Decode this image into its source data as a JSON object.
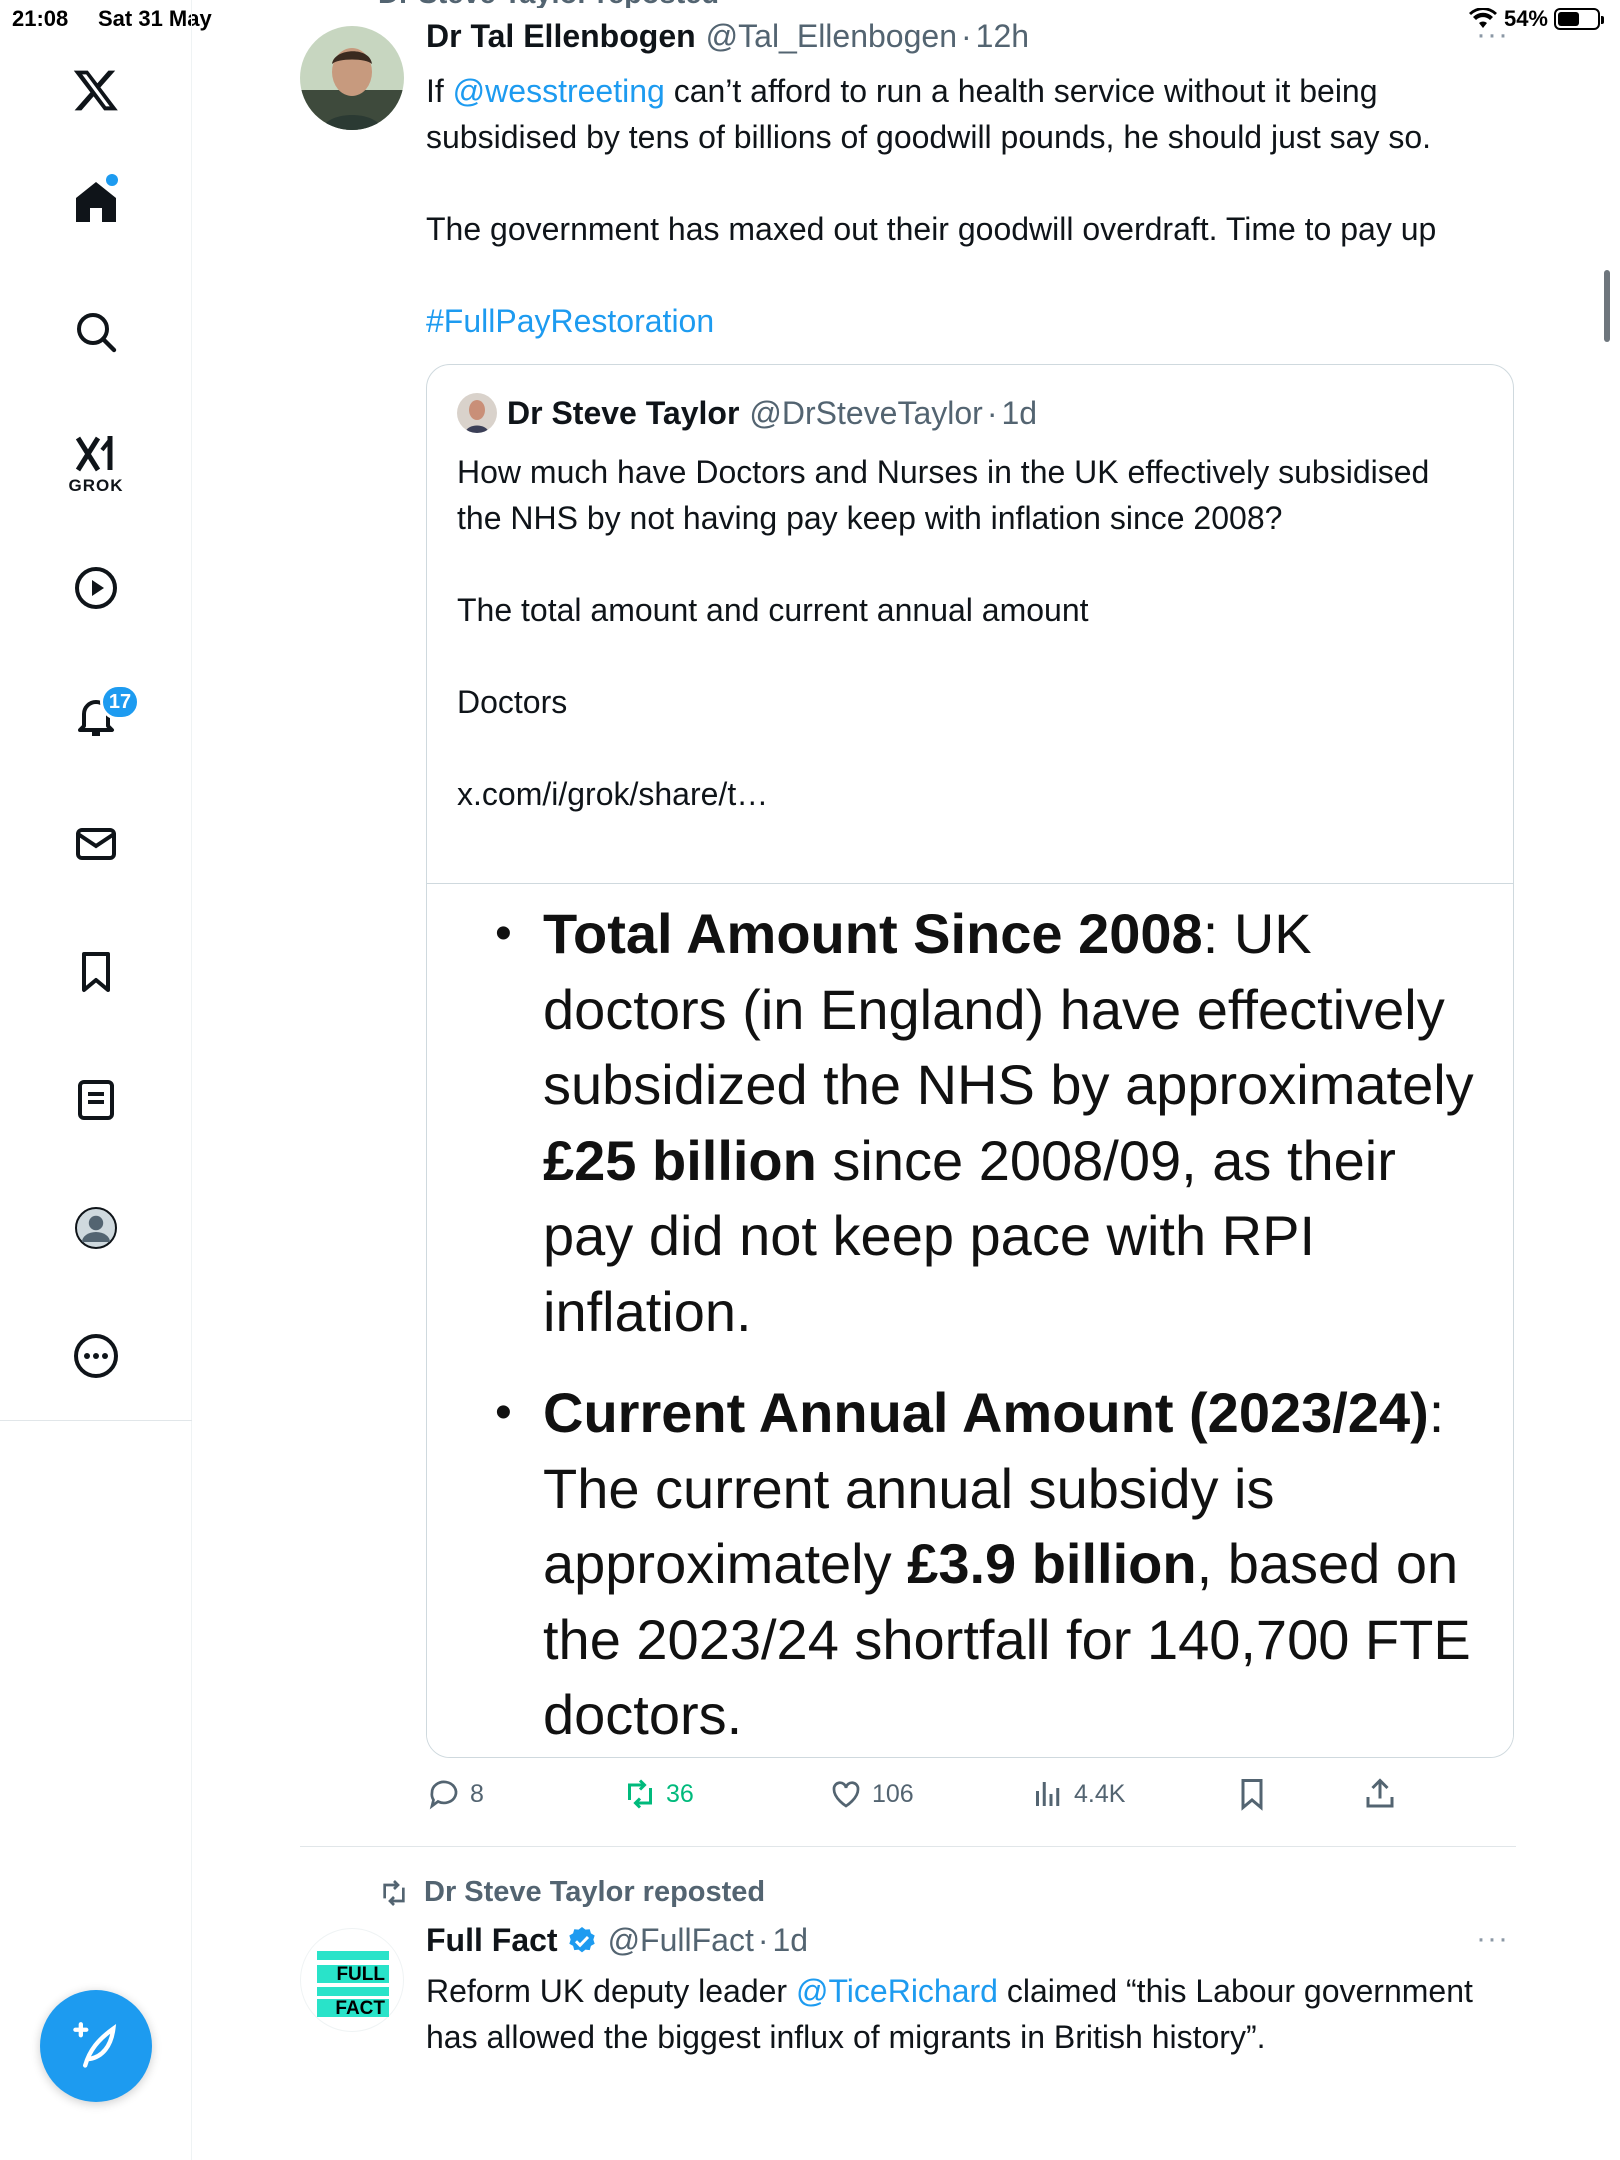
{
  "status_bar": {
    "time": "21:08",
    "date": "Sat 31 May",
    "battery_percent": "54%"
  },
  "sidebar": {
    "items": [
      "home",
      "explore",
      "grok",
      "video",
      "notifications",
      "messages",
      "bookmarks",
      "lists",
      "profile",
      "more"
    ],
    "grok_label": "GROK",
    "notification_count": "17"
  },
  "tweet1": {
    "top_context": "Dr Steve Taylor reposted",
    "author_name": "Dr Tal Ellenbogen",
    "handle": "@Tal_Ellenbogen",
    "separator": "·",
    "time": "12h",
    "text": {
      "prefix": "If ",
      "mention": "@wesstreeting",
      "line1_rest": " can’t afford to run a health service without it being subsidised by tens of billions of goodwill pounds, he should just say so.",
      "line2": "The government has maxed out their goodwill overdraft. Time to pay up",
      "hashtag": "#FullPayRestoration"
    },
    "quote": {
      "author_name": "Dr Steve Taylor",
      "handle": "@DrSteveTaylor",
      "time": "1d",
      "text_line1": "How much have Doctors and Nurses in the UK effectively subsidised the NHS by not having pay keep with inflation since 2008?",
      "text_line2": "The total amount and current annual amount",
      "text_line3": "Doctors",
      "text_link": "x.com/i/grok/share/t…",
      "image": {
        "bullet1_bold": "Total Amount Since 2008",
        "bullet1_a": ": UK doctors (in England) have effectively subsidized the NHS by approximately ",
        "bullet1_bold2": "£25 billion",
        "bullet1_b": " since 2008/09, as their pay did not keep pace with RPI inflation.",
        "bullet2_bold": "Current Annual Amount (2023/24)",
        "bullet2_a": ": The current annual subsidy is approximately ",
        "bullet2_bold2": "£3.9 billion",
        "bullet2_b": ", based on the 2023/24 shortfall for 140,700 FTE doctors."
      }
    },
    "actions": {
      "replies": "8",
      "reposts": "36",
      "likes": "106",
      "views": "4.4K"
    }
  },
  "tweet2": {
    "repost_label": "Dr Steve Taylor reposted",
    "author_name": "Full Fact",
    "handle": "@FullFact",
    "time": "1d",
    "logo_text_1": "FULL",
    "logo_text_2": "FACT",
    "text_prefix": "Reform UK deputy leader ",
    "mention": "@TiceRichard",
    "text_rest": " claimed “this Labour government has allowed the biggest influx of migrants in British history”."
  },
  "colors": {
    "accent": "#1d9bf0",
    "repost_green": "#00ba7c",
    "muted": "#536471",
    "full_fact_teal": "#29e3c9"
  }
}
